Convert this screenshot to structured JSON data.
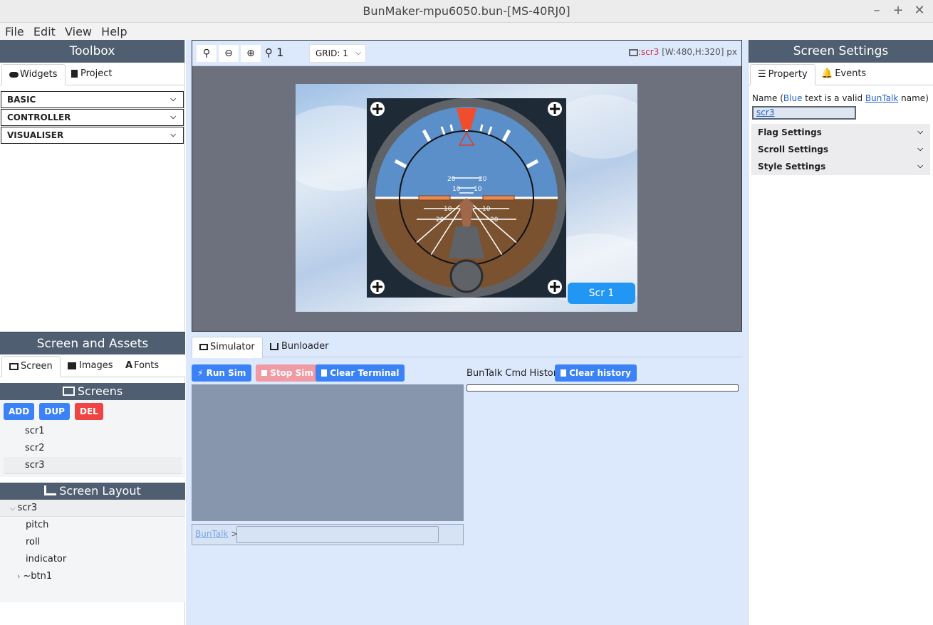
{
  "window": {
    "title": "BunMaker-mpu6050.bun-[MS-40RJ0]",
    "minimize": "–",
    "maximize": "+",
    "close": "✕"
  },
  "menu": [
    "File",
    "Edit",
    "View",
    "Help"
  ],
  "toolbox": {
    "title": "Toolbox",
    "tabs": [
      "Widgets",
      "Project"
    ],
    "sections": [
      "BASIC",
      "CONTROLLER",
      "VISUALISER"
    ]
  },
  "assets": {
    "title": "Screen and Assets",
    "tabs": [
      "Screen",
      "Images",
      "Fonts"
    ],
    "screens_title": "Screens",
    "buttons": {
      "add": "ADD",
      "dup": "DUP",
      "del": "DEL"
    },
    "screens": [
      "scr1",
      "scr2",
      "scr3"
    ],
    "selected_screen": "scr3",
    "layout_title": "Screen Layout",
    "layout_root": "scr3",
    "layout_children": [
      "pitch",
      "roll",
      "indicator"
    ],
    "layout_group": "~btn1"
  },
  "canvas": {
    "zoom_level": "1",
    "grid": "GRID: 1",
    "screen_name": ":scr3",
    "screen_dims": "[W:480,H:320] px",
    "scr_button": "Scr 1",
    "pitch_marks": [
      "20",
      "20",
      "10",
      "10",
      "10",
      "10",
      "20",
      "20"
    ]
  },
  "bottom": {
    "tabs": [
      "Simulator",
      "Bunloader"
    ],
    "run_sim": "Run Sim",
    "stop_sim": "Stop Sim",
    "clear_terminal": "Clear Terminal",
    "history_label": "BunTalk Cmd History",
    "clear_history": "Clear history",
    "prompt_link": "BunTalk",
    "prompt_symbol": ">"
  },
  "settings": {
    "title": "Screen Settings",
    "tabs": [
      "Property",
      "Events"
    ],
    "name_label_pre": "Name (",
    "name_label_blue": "Blue",
    "name_label_mid": " text is a valid ",
    "name_label_link": "BunTalk",
    "name_label_post": " name)",
    "name_value": "scr3",
    "groups": [
      "Flag Settings",
      "Scroll Settings",
      "Style Settings"
    ]
  },
  "colors": {
    "header": "#4f5e71",
    "primary": "#3b82f6",
    "danger": "#ef4444",
    "stop_disabled": "#f09aa3",
    "sky": "#5b8fc9",
    "ground": "#7a5230"
  }
}
